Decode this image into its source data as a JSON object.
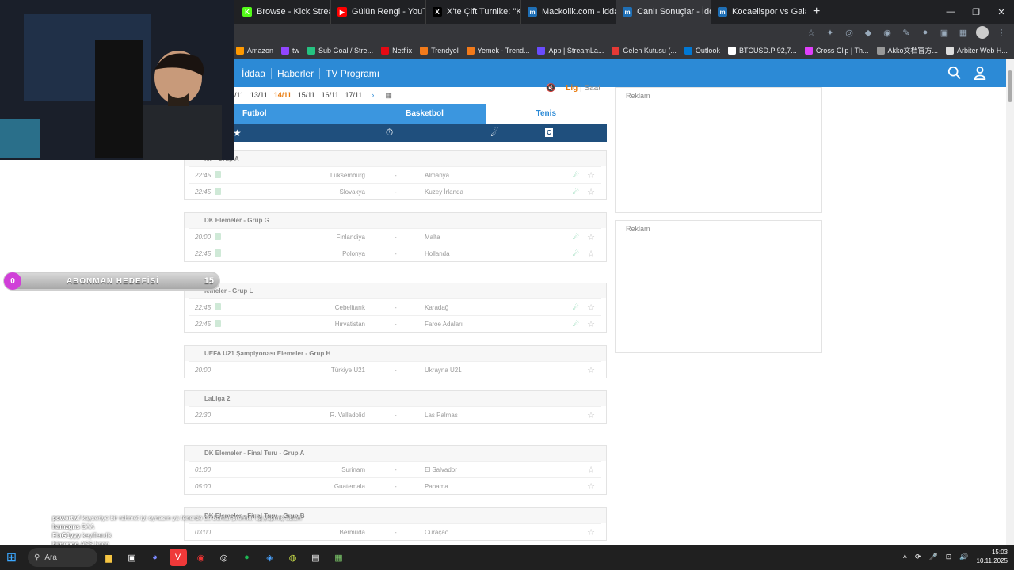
{
  "browser": {
    "tabs": [
      {
        "label": "Browse - Kick Streaming",
        "fav_color": "#53fc18",
        "fav": "K"
      },
      {
        "label": "Gülün Rengi - YouTube",
        "fav_color": "#ff0000",
        "fav": "▶"
      },
      {
        "label": "X'te Çift Turnike: \"Kocaeli'de",
        "fav_color": "#000000",
        "fav": "X"
      },
      {
        "label": "Mackolik.com - iddaa,canlı",
        "fav_color": "#1f6fb5",
        "fav": "m"
      },
      {
        "label": "Canlı Sonuçlar - İddaa Sonu",
        "fav_color": "#1f6fb5",
        "fav": "m"
      },
      {
        "label": "Kocaelispor vs Galatasaray,",
        "fav_color": "#1f6fb5",
        "fav": "m"
      }
    ],
    "bookmarks": [
      {
        "label": "Amazon",
        "color": "#ff9900"
      },
      {
        "label": "tw",
        "color": "#9146ff"
      },
      {
        "label": "Sub Goal / Stre...",
        "color": "#25c281"
      },
      {
        "label": "Netflix",
        "color": "#e50914"
      },
      {
        "label": "Trendyol",
        "color": "#f27a1a"
      },
      {
        "label": "Yemek - Trend...",
        "color": "#f27a1a"
      },
      {
        "label": "App | StreamLa...",
        "color": "#6a4cff"
      },
      {
        "label": "Gelen Kutusu (...",
        "color": "#e53935"
      },
      {
        "label": "Outlook",
        "color": "#0078d4"
      },
      {
        "label": "BTCUSD.P 92,7...",
        "color": "#ffffff"
      },
      {
        "label": "Cross Clip | Th...",
        "color": "#e040fb"
      },
      {
        "label": "Akko文档官方...",
        "color": "#999999"
      },
      {
        "label": "Arbiter Web H...",
        "color": "#dddddd"
      }
    ]
  },
  "site": {
    "nav": [
      "İddaa",
      "Haberler",
      "TV Programı"
    ]
  },
  "dates": [
    "/11",
    "13/11",
    "14/11",
    "15/11",
    "16/11",
    "17/11"
  ],
  "active_date": "14/11",
  "sort_labels": {
    "lig": "Lig",
    "saat": "Saat"
  },
  "sport_tabs": [
    "Futbol",
    "Basketbol",
    "Tenis"
  ],
  "leagues": [
    {
      "name": "ler - Grup A",
      "matches": [
        {
          "time": "22:45",
          "home": "Lüksemburg",
          "away": "Almanya",
          "live": true
        },
        {
          "time": "22:45",
          "home": "Slovakya",
          "away": "Kuzey İrlanda",
          "live": true
        }
      ]
    },
    {
      "name": "DK Elemeler - Grup G",
      "matches": [
        {
          "time": "20:00",
          "home": "Finlandiya",
          "away": "Malta",
          "live": true
        },
        {
          "time": "22:45",
          "home": "Polonya",
          "away": "Hollanda",
          "live": true
        }
      ]
    },
    {
      "name": "lemeler - Grup L",
      "matches": [
        {
          "time": "22:45",
          "home": "Cebelitarık",
          "away": "Karadağ",
          "live": true
        },
        {
          "time": "22:45",
          "home": "Hırvatistan",
          "away": "Faroe Adaları",
          "live": true
        }
      ]
    },
    {
      "name": "UEFA U21 Şampiyonası Elemeler - Grup H",
      "matches": [
        {
          "time": "20:00",
          "home": "Türkiye U21",
          "away": "Ukrayna U21",
          "live": false
        }
      ]
    },
    {
      "name": "LaLiga 2",
      "matches": [
        {
          "time": "22:30",
          "home": "R. Valladolid",
          "away": "Las Palmas",
          "live": false
        }
      ]
    },
    {
      "name": "DK Elemeler - Final Turu - Grup A",
      "matches": [
        {
          "time": "01:00",
          "home": "Surinam",
          "away": "El Salvador",
          "live": false
        },
        {
          "time": "05:00",
          "home": "Guatemala",
          "away": "Panama",
          "live": false
        }
      ]
    },
    {
      "name": "DK Elemeler - Final Turu - Grup B",
      "matches": [
        {
          "time": "03:00",
          "home": "Bermuda",
          "away": "Curaçao",
          "live": false
        }
      ]
    }
  ],
  "ads": [
    "Reklam",
    "Reklam"
  ],
  "stream_overlay": {
    "goal_current": "0",
    "goal_label": "ABONMAN HEDEFİSİ",
    "goal_target": "15",
    "chat": [
      {
        "user": "powertwf",
        "text": "kayseriye bir rahmet iyi oynasın ya fenerde de bunlar premier lig yapmış adam"
      },
      {
        "user": "hamzgns",
        "text": "SAA"
      },
      {
        "user": "FlaG1yyy",
        "text": "keyiflendik"
      },
      {
        "user": "himenoo",
        "text": "ASS hggg"
      }
    ]
  },
  "taskbar": {
    "search": "Ara",
    "time": "15:03",
    "date": "10.11.2025"
  },
  "colors": {
    "brand": "#2c8ad6",
    "filterbar": "#1f4f7d",
    "active_date": "#e97a0c",
    "live_icon": "#2bb573"
  }
}
